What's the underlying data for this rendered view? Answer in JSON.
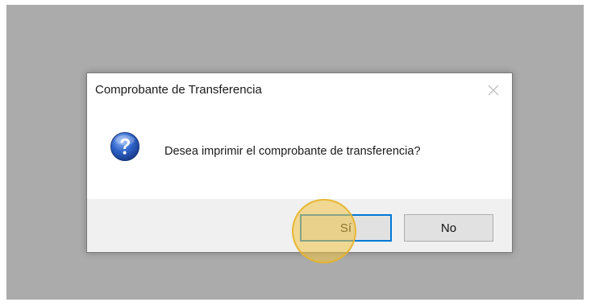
{
  "dialog": {
    "title": "Comprobante de Transferencia",
    "message": "Desea imprimir el comprobante de transferencia?",
    "icon": "question-icon",
    "buttons": {
      "yes_label": "Sí",
      "no_label": "No"
    }
  },
  "colors": {
    "backdrop": "#ababab",
    "footer": "#f0f0f0",
    "focus_border": "#0078d7",
    "click_highlight": "#f0c446"
  }
}
